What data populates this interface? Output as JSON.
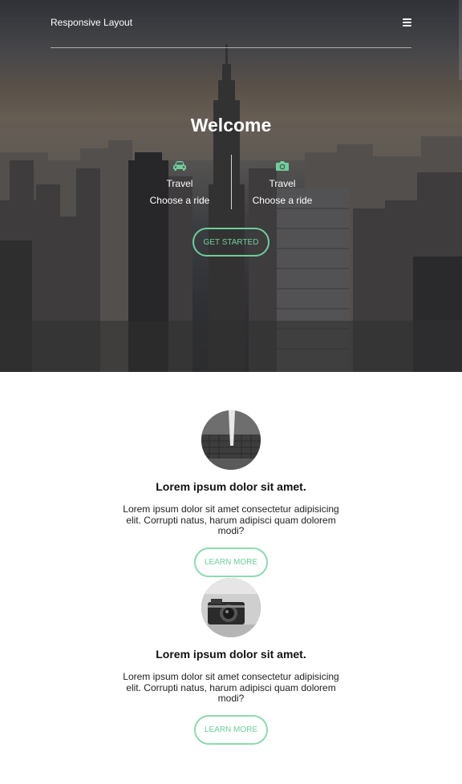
{
  "navbar": {
    "brand": "Responsive Layout",
    "menu_icon": "hamburger-menu-icon"
  },
  "hero": {
    "title": "Welcome",
    "features": [
      {
        "icon": "car-icon",
        "title": "Travel",
        "subtitle": "Choose a ride"
      },
      {
        "icon": "camera-icon",
        "title": "Travel",
        "subtitle": "Choose a ride"
      }
    ],
    "cta_label": "GET STARTED",
    "background": "city-skyline-photo"
  },
  "cards": [
    {
      "image": "building-photo",
      "title": "Lorem ipsum dolor sit amet.",
      "text": "Lorem ipsum dolor sit amet consectetur adipisicing elit. Corrupti natus, harum adipisci quam dolorem modi?",
      "button_label": "LEARN MORE"
    },
    {
      "image": "camera-photo",
      "title": "Lorem ipsum dolor sit amet.",
      "text": "Lorem ipsum dolor sit amet consectetur adipisicing elit. Corrupti natus, harum adipisci quam dolorem modi?",
      "button_label": "LEARN MORE"
    }
  ],
  "colors": {
    "accent": "#6fce9c",
    "text": "#111111",
    "background": "#ffffff"
  }
}
